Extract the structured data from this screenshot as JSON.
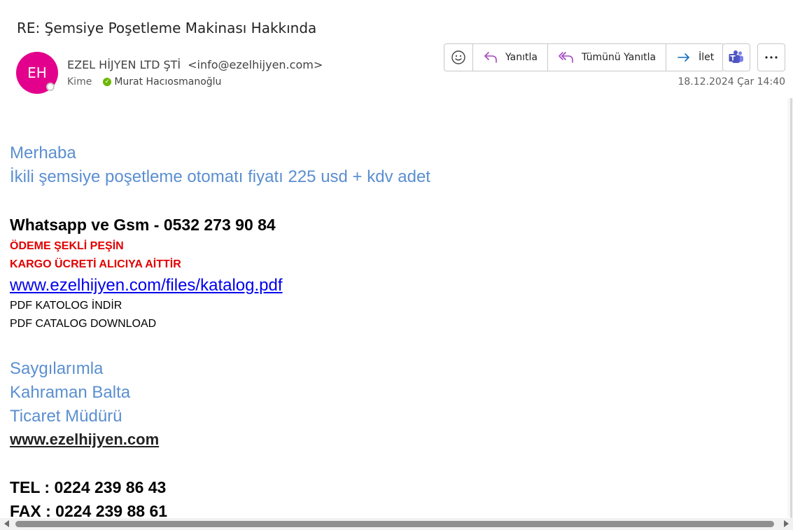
{
  "email": {
    "subject": "RE: Şemsiye Poşetleme Makinası Hakkında",
    "avatar_initials": "EH",
    "avatar_color": "#e3008c",
    "sender_name": "EZEL HİJYEN LTD ŞTİ",
    "sender_email": "<info@ezelhijyen.com>",
    "to_label": "Kime",
    "recipient": "Murat Hacıosmanoğlu",
    "datetime": "18.12.2024 Çar 14:40"
  },
  "toolbar": {
    "emoji_icon": "smiley-icon",
    "reply_label": "Yanıtla",
    "reply_all_label": "Tümünü Yanıtla",
    "forward_label": "İlet",
    "accent": "#a34ac2",
    "forward_accent": "#0f6cbd"
  },
  "body": {
    "greeting": "Merhaba",
    "price_line": "İkili şemsiye poşetleme otomatı fiyatı 225 usd + kdv adet",
    "whatsapp": "Whatsapp ve Gsm - 0532 273 90 84",
    "payment": "ÖDEME ŞEKLİ PEŞİN",
    "cargo": "KARGO ÜCRETİ ALICIYA AİTTİR",
    "catalog_link": "www.ezelhijyen.com/files/katalog.pdf",
    "pdf_tr": "PDF KATOLOG İNDİR",
    "pdf_en": "PDF CATALOG DOWNLOAD",
    "regards": "Saygılarımla",
    "name": "Kahraman Balta",
    "title": "Ticaret Müdürü",
    "website": "www.ezelhijyen.com",
    "tel": "TEL : 0224 239 86 43",
    "fax": "FAX : 0224 239 88 61"
  }
}
